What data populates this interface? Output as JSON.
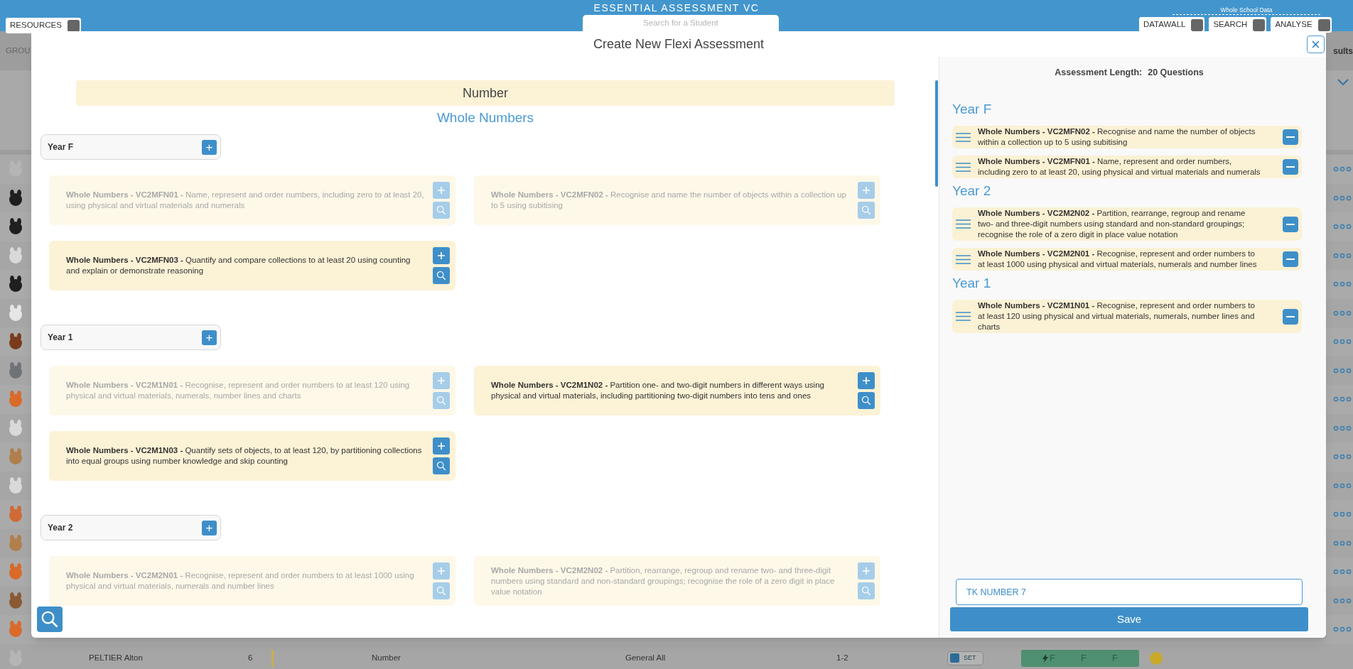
{
  "topbar": {
    "title": "ESSENTIAL ASSESSMENT VC",
    "search": {
      "placeholder": "Search for a Student"
    },
    "left_buttons": [
      "RESOURCES"
    ],
    "right_label": "Whole School Data",
    "right_buttons": [
      "DATAWALL",
      "SEARCH",
      "ANALYSE"
    ]
  },
  "background": {
    "group_header": "GROU",
    "results_header": "sults",
    "avatars": [
      {
        "color": "#b5b5b5"
      },
      {
        "color": "#1f1f1f"
      },
      {
        "color": "#1f1f1f"
      },
      {
        "color": "#d9d9d9"
      },
      {
        "color": "#1f1f1f"
      },
      {
        "color": "#e6e6e6"
      },
      {
        "color": "#7a3b1c"
      },
      {
        "color": "#6f7378"
      },
      {
        "color": "#d96a2a"
      },
      {
        "color": "#d9d9d9"
      },
      {
        "color": "#b07f4d"
      },
      {
        "color": "#d9d9d9"
      },
      {
        "color": "#cf6a36"
      },
      {
        "color": "#b07f4d"
      },
      {
        "color": "#d96a2a"
      },
      {
        "color": "#8a5a35"
      },
      {
        "color": "#d96a2a"
      },
      {
        "color": "#b5b5b5"
      }
    ],
    "student_row": {
      "name": "PELTIER Alton",
      "year": "6",
      "strand": "Number",
      "test": "General All",
      "level": "1-2",
      "set_label": "SET",
      "results": [
        "F",
        "F",
        "F"
      ]
    }
  },
  "modal": {
    "title": "Create New Flexi Assessment",
    "close": "×",
    "strand": "Number",
    "topic": "Whole Numbers",
    "years": [
      {
        "label": "Year F",
        "add": "+",
        "cards": [
          {
            "code": "**Whole Numbers - VC2MFN01 -** Name, represent and order numbers, including zero to at least 20, using physical and virtual materials and numerals",
            "added": true
          },
          {
            "code": "**Whole Numbers - VC2MFN02 -** Recognise and name the number of objects within a collection up to 5 using subitising",
            "added": true
          },
          {
            "code": "**Whole Numbers - VC2MFN03 -** Quantify and compare collections to at least 20 using counting and explain or demonstrate reasoning",
            "added": false
          }
        ]
      },
      {
        "label": "Year 1",
        "add": "+",
        "cards": [
          {
            "code": "**Whole Numbers - VC2M1N01 -** Recognise, represent and order numbers to at least 120 using physical and virtual materials, numerals, number lines and charts",
            "added": true
          },
          {
            "code": "**Whole Numbers - VC2M1N02 -** Partition one- and two-digit numbers in different ways using physical and virtual materials, including partitioning two-digit numbers into tens and ones",
            "added": false
          },
          {
            "code": "**Whole Numbers - VC2M1N03 -** Quantify sets of objects, to at least 120, by partitioning collections into equal groups using number knowledge and skip counting",
            "added": false
          }
        ]
      },
      {
        "label": "Year 2",
        "add": "+",
        "cards": [
          {
            "code": "**Whole Numbers - VC2M2N01 -** Recognise, represent and order numbers to at least 1000 using physical and virtual materials, numerals and number lines",
            "added": true
          },
          {
            "code": "**Whole Numbers - VC2M2N02 -** Partition, rearrange, regroup and rename two- and three-digit numbers using standard and non-standard groupings; recognise the role of a zero digit in place value notation",
            "added": true
          }
        ]
      }
    ],
    "length_label": "Assessment Length:",
    "length_value": "20 Questions",
    "selected_groups": [
      {
        "label": "Year F",
        "items": [
          "**Whole Numbers - VC2MFN02 -** Recognise and name the number of objects within a collection up to 5 using subitising",
          "**Whole Numbers - VC2MFN01 -** Name, represent and order numbers, including zero to at least 20, using physical and virtual materials and numerals"
        ]
      },
      {
        "label": "Year 2",
        "items": [
          "**Whole Numbers - VC2M2N02 -** Partition, rearrange, regroup and rename two- and three-digit numbers using standard and non-standard groupings; recognise the role of a zero digit in place value notation",
          "**Whole Numbers - VC2M2N01 -** Recognise, represent and order numbers to at least 1000 using physical and virtual materials, numerals and number lines"
        ]
      },
      {
        "label": "Year 1",
        "items": [
          "**Whole Numbers - VC2M1N01 -** Recognise, represent and order numbers to at least 120 using physical and virtual materials, numerals, number lines and charts"
        ]
      }
    ],
    "name_field": {
      "value": "TK NUMBER 7"
    },
    "save": "Save"
  }
}
